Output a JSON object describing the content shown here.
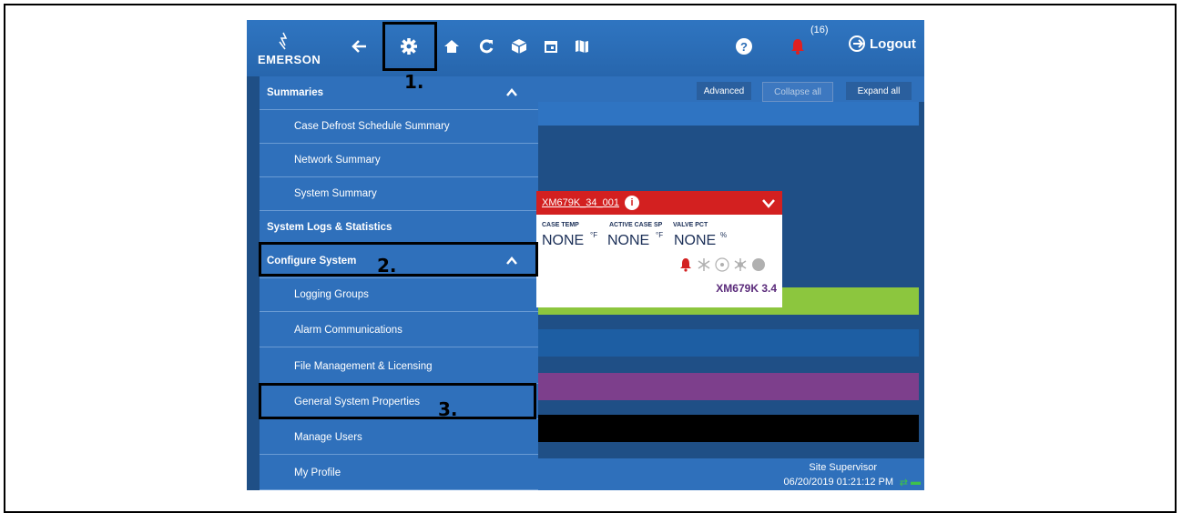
{
  "toolbar": {
    "brand": "EMERSON",
    "alarm_count": "(16)",
    "logout_label": "Logout",
    "icons": [
      "back-arrow-icon",
      "gear-icon",
      "home-icon",
      "refresh-icon",
      "cube-icon",
      "calendar-icon",
      "map-icon",
      "help-icon",
      "bell-icon",
      "logout-icon"
    ]
  },
  "steps": {
    "one": "1.",
    "two": "2.",
    "three": "3."
  },
  "menu": {
    "summaries": "Summaries",
    "case_defrost": "Case Defrost Schedule Summary",
    "network_summary": "Network Summary",
    "system_summary": "System Summary",
    "logs": "System Logs & Statistics",
    "configure": "Configure System",
    "logging_groups": "Logging Groups",
    "alarm_comms": "Alarm Communications",
    "file_mgmt": "File Management & Licensing",
    "general_props": "General System Properties",
    "manage_users": "Manage Users",
    "my_profile": "My Profile"
  },
  "content": {
    "advanced": "Advanced",
    "collapse_all": "Collapse all",
    "expand_all": "Expand all"
  },
  "card": {
    "title": "XM679K_34_001",
    "col1_label": "CASE TEMP",
    "col2_label": "ACTIVE CASE SP",
    "col3_label": "VALVE PCT",
    "col1_value": "NONE",
    "col2_value": "NONE",
    "col3_value": "NONE",
    "unit_f": "°F",
    "unit_pct": "%",
    "model": "XM679K 3.4"
  },
  "footer": {
    "role": "Site Supervisor",
    "datetime": "06/20/2019 01:21:12 PM"
  },
  "colors": {
    "accent_blue": "#2f70bb",
    "alarm_red": "#d32020",
    "band_green": "#8cc63e",
    "band_purple": "#7d3f8c"
  }
}
